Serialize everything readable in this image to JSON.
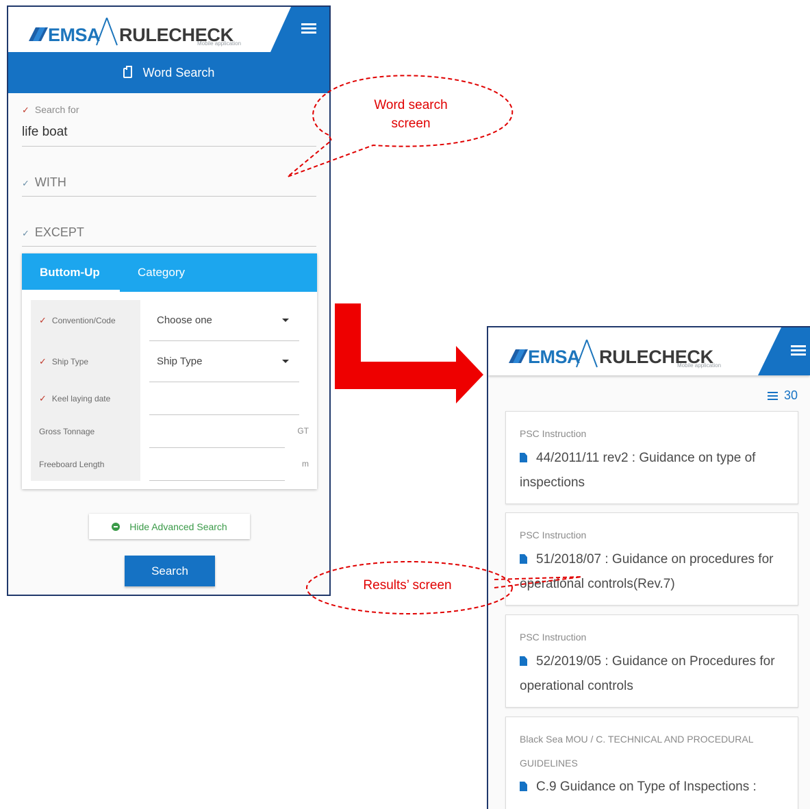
{
  "app": {
    "logo_emsa": "EMSA",
    "logo_rulecheck": "RULECHECK",
    "logo_subtitle": "Mobile application",
    "menu_icon": "hamburger-icon"
  },
  "word_search": {
    "title": "Word Search",
    "search_label": "Search for",
    "search_value": "life boat",
    "with_label": "WITH",
    "except_label": "EXCEPT",
    "tabs": [
      "Buttom-Up",
      "Category"
    ],
    "rows": [
      {
        "label": "Convention/Code",
        "value": "Choose one",
        "check": "✓"
      },
      {
        "label": "Ship Type",
        "value": "Ship Type",
        "check": "✓"
      },
      {
        "label": "Keel laying date",
        "value": "",
        "check": "✓"
      },
      {
        "label": "Gross Tonnage",
        "value": "",
        "unit": "GT"
      },
      {
        "label": "Freeboard Length",
        "value": "",
        "unit": "m"
      }
    ],
    "hide_button": "Hide Advanced Search",
    "search_button": "Search"
  },
  "results": {
    "count": "30",
    "items": [
      {
        "category": "PSC Instruction",
        "title": "44/2011/11 rev2 : Guidance on type of inspections"
      },
      {
        "category": "PSC Instruction",
        "title": "51/2018/07 : Guidance on procedures for operational controls(Rev.7)"
      },
      {
        "category": "PSC Instruction",
        "title": "52/2019/05 : Guidance on Procedures for operational controls"
      },
      {
        "category": "Black Sea MOU / C. TECHNICAL AND PROCEDURAL GUIDELINES",
        "title": "C.9 Guidance on Type of Inspections :"
      }
    ]
  },
  "annotations": {
    "word_search_line1": "Word search",
    "word_search_line2": "screen",
    "results": "Results’ screen"
  },
  "colors": {
    "primary": "#1572c4",
    "tab_bar": "#1ca6ee",
    "annotation": "#e00000",
    "green": "#3a9a48"
  }
}
